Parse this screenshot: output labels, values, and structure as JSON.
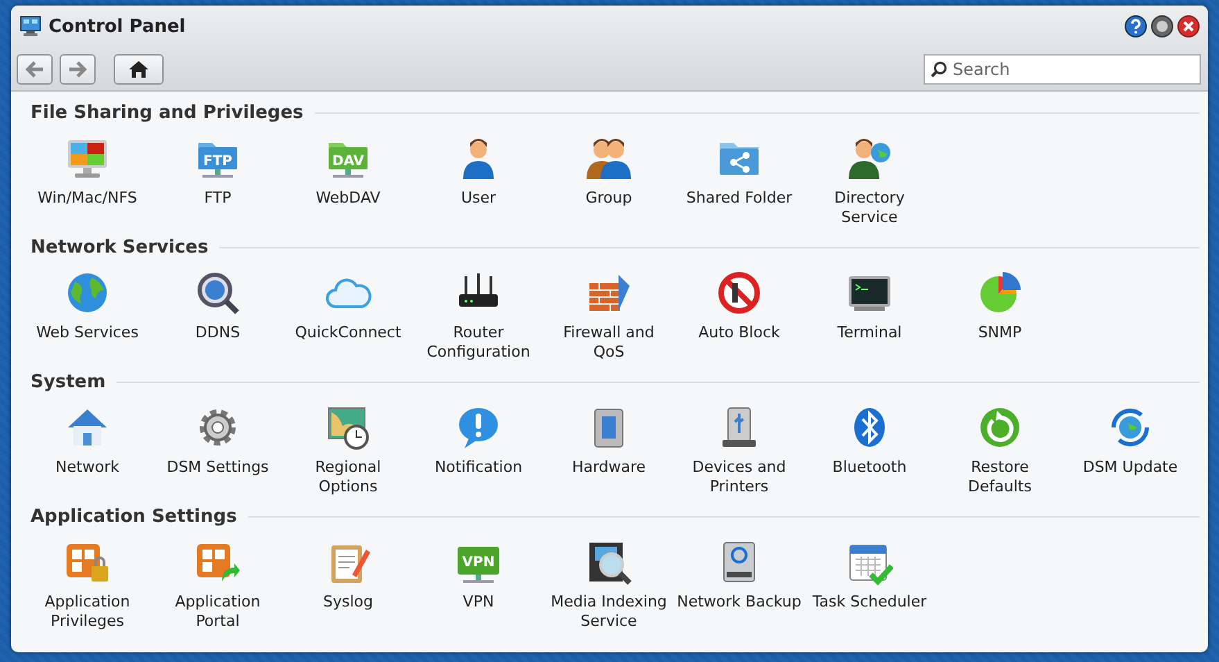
{
  "window": {
    "title": "Control Panel"
  },
  "toolbar": {
    "search": {
      "placeholder": "Search"
    }
  },
  "sections": [
    {
      "title": "File Sharing and Privileges",
      "items": [
        {
          "label": "Win/Mac/NFS"
        },
        {
          "label": "FTP",
          "icon_text": "FTP"
        },
        {
          "label": "WebDAV",
          "icon_text": "DAV"
        },
        {
          "label": "User"
        },
        {
          "label": "Group"
        },
        {
          "label": "Shared Folder"
        },
        {
          "label": "Directory Service"
        }
      ]
    },
    {
      "title": "Network Services",
      "items": [
        {
          "label": "Web Services"
        },
        {
          "label": "DDNS"
        },
        {
          "label": "QuickConnect"
        },
        {
          "label": "Router Configuration"
        },
        {
          "label": "Firewall and QoS"
        },
        {
          "label": "Auto Block"
        },
        {
          "label": "Terminal"
        },
        {
          "label": "SNMP"
        }
      ]
    },
    {
      "title": "System",
      "items": [
        {
          "label": "Network"
        },
        {
          "label": "DSM Settings"
        },
        {
          "label": "Regional Options"
        },
        {
          "label": "Notification"
        },
        {
          "label": "Hardware"
        },
        {
          "label": "Devices and Printers"
        },
        {
          "label": "Bluetooth"
        },
        {
          "label": "Restore Defaults"
        },
        {
          "label": "DSM Update"
        }
      ]
    },
    {
      "title": "Application Settings",
      "items": [
        {
          "label": "Application Privileges"
        },
        {
          "label": "Application Portal"
        },
        {
          "label": "Syslog"
        },
        {
          "label": "VPN",
          "icon_text": "VPN"
        },
        {
          "label": "Media Indexing Service"
        },
        {
          "label": "Network Backup"
        },
        {
          "label": "Task Scheduler"
        }
      ]
    }
  ]
}
